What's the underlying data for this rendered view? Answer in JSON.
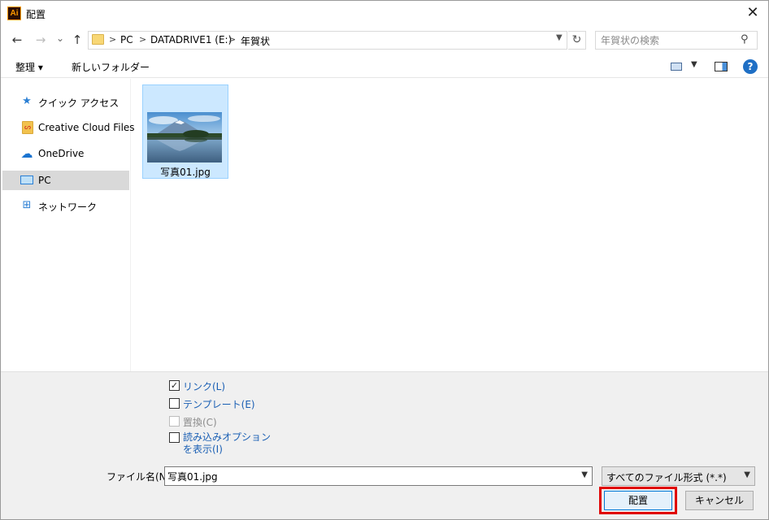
{
  "window": {
    "title": "配置",
    "app_icon_text": "Ai",
    "close_glyph": "✕"
  },
  "nav": {
    "back_glyph": "←",
    "forward_glyph": "→",
    "recent_glyph": "⌄",
    "up_glyph": "↑",
    "breadcrumb": [
      "PC",
      "DATADRIVE1 (E:)",
      "年賀状"
    ],
    "separator": ">",
    "refresh_glyph": "↻",
    "search_placeholder": "年賀状の検索"
  },
  "toolbar": {
    "organize": "整理 ▾",
    "new_folder": "新しいフォルダー",
    "help_glyph": "?"
  },
  "sidebar": {
    "items": [
      {
        "label": "クイック アクセス",
        "icon": "star-icon",
        "glyph": "★",
        "color": "#2b7fd4",
        "selected": false
      },
      {
        "label": "Creative Cloud Files",
        "icon": "creative-cloud-folder-icon",
        "glyph": "▰",
        "color": "#f2c24e",
        "selected": false
      },
      {
        "label": "OneDrive",
        "icon": "cloud-icon",
        "glyph": "☁",
        "color": "#1a73d0",
        "selected": false
      },
      {
        "label": "PC",
        "icon": "computer-icon",
        "glyph": "▭",
        "color": "#2b7fd4",
        "selected": true
      },
      {
        "label": "ネットワーク",
        "icon": "network-icon",
        "glyph": "⊞",
        "color": "#2b7fd4",
        "selected": false
      }
    ]
  },
  "files": [
    {
      "name": "写真01.jpg",
      "selected": true
    }
  ],
  "options": [
    {
      "label": "リンク(L)",
      "checked": true,
      "disabled": false
    },
    {
      "label": "テンプレート(E)",
      "checked": false,
      "disabled": false
    },
    {
      "label": "置換(C)",
      "checked": false,
      "disabled": true
    },
    {
      "label": "読み込みオプションを表示(I)",
      "checked": false,
      "disabled": false
    }
  ],
  "filename": {
    "label": "ファイル名(N):",
    "value": "写真01.jpg"
  },
  "filetype": {
    "selected": "すべてのファイル形式 (*.*)"
  },
  "buttons": {
    "place": "配置",
    "cancel": "キャンセル"
  },
  "colors": {
    "selection_bg": "#cce8ff",
    "highlight_border": "#e00000",
    "link_text": "#1a5fb4"
  }
}
